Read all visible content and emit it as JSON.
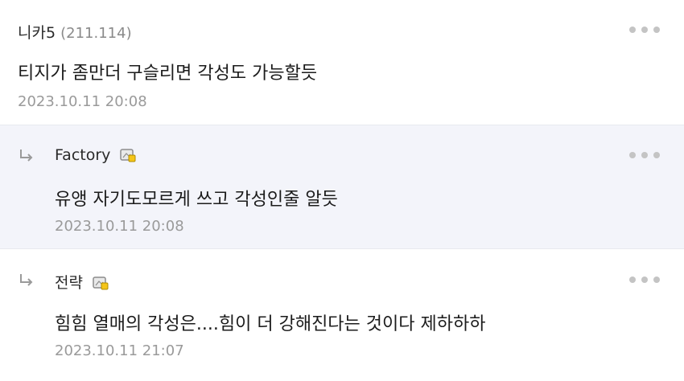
{
  "comments": [
    {
      "author": "니카5",
      "ip": "(211.114)",
      "text": "티지가 좀만더 구슬리면 각성도 가능할듯",
      "date": "2023.10.11 20:08"
    },
    {
      "author": "Factory",
      "text": "유앵 자기도모르게 쓰고 각성인줄 알듯",
      "date": "2023.10.11 20:08",
      "is_reply": true
    },
    {
      "author": "전략",
      "text": "힘힘 열매의 각성은....힘이 더 강해진다는 것이다 제하하하",
      "date": "2023.10.11 21:07",
      "is_reply": true
    }
  ],
  "icons": {
    "more": "more-options-icon",
    "reply": "reply-arrow-icon",
    "badge": "gallery-member-badge-icon"
  },
  "colors": {
    "reply_background": "#f3f4fa",
    "badge_yellow": "#f5c518"
  }
}
